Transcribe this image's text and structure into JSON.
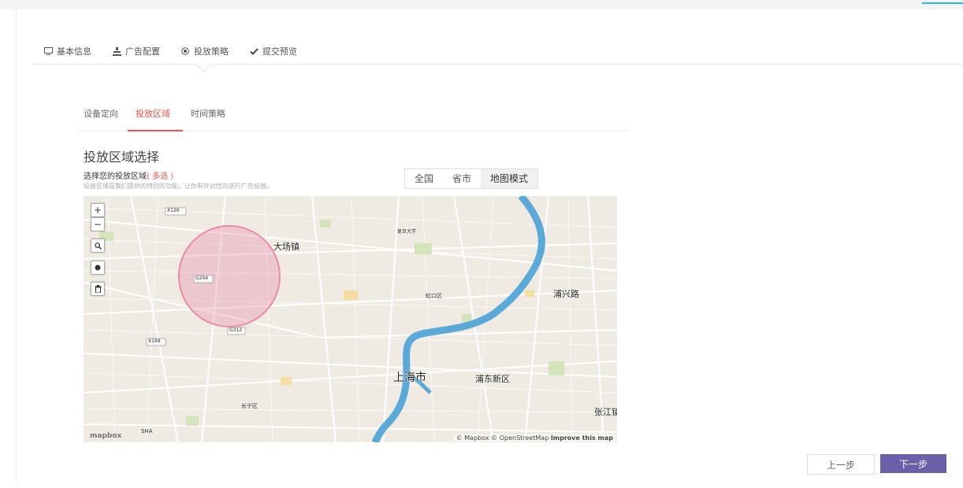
{
  "steps": [
    {
      "label": "基本信息",
      "icon": "monitor-icon"
    },
    {
      "label": "广告配置",
      "icon": "stamp-icon"
    },
    {
      "label": "投放策略",
      "icon": "target-icon"
    },
    {
      "label": "提交预览",
      "icon": "check-icon"
    }
  ],
  "subtabs": [
    "设备定向",
    "投放区域",
    "时间策略"
  ],
  "active_subtab": "投放区域",
  "section_title": "投放区域选择",
  "selector": {
    "label": "选择您的投放区域",
    "multi": "( 多选 )",
    "hint": "投放区域是我们提供的特别的功能，让你有针对性的进行广告投放。"
  },
  "modes": [
    "全国",
    "省市",
    "地图模式"
  ],
  "active_mode": "地图模式",
  "map": {
    "controls": [
      "zoom-in",
      "zoom-out",
      "search",
      "draw-circle",
      "delete"
    ],
    "labels": {
      "dachang": "大场镇",
      "shanghai": "上海市",
      "pudong": "浦东新区",
      "puxing": "浦兴路",
      "zhangjiang": "张江镇",
      "hongkou": "虹口区",
      "fudan": "复旦大学",
      "changning": "长宁区",
      "road_x126": "X126",
      "road_g204": "G204",
      "road_g312": "G312",
      "road_x199": "X199",
      "sha": "SHA"
    },
    "logo": "mapbox",
    "attribution_a": "© Mapbox © OpenStreetMap ",
    "attribution_b": "Improve this map",
    "colors": {
      "river": "#5aa9d8",
      "circle": "#e88aa8",
      "land": "#efeae2"
    }
  },
  "buttons": {
    "prev": "上一步",
    "next": "下一步"
  },
  "colors": {
    "accent": "#f0524a",
    "primary": "#6a5fa8"
  }
}
